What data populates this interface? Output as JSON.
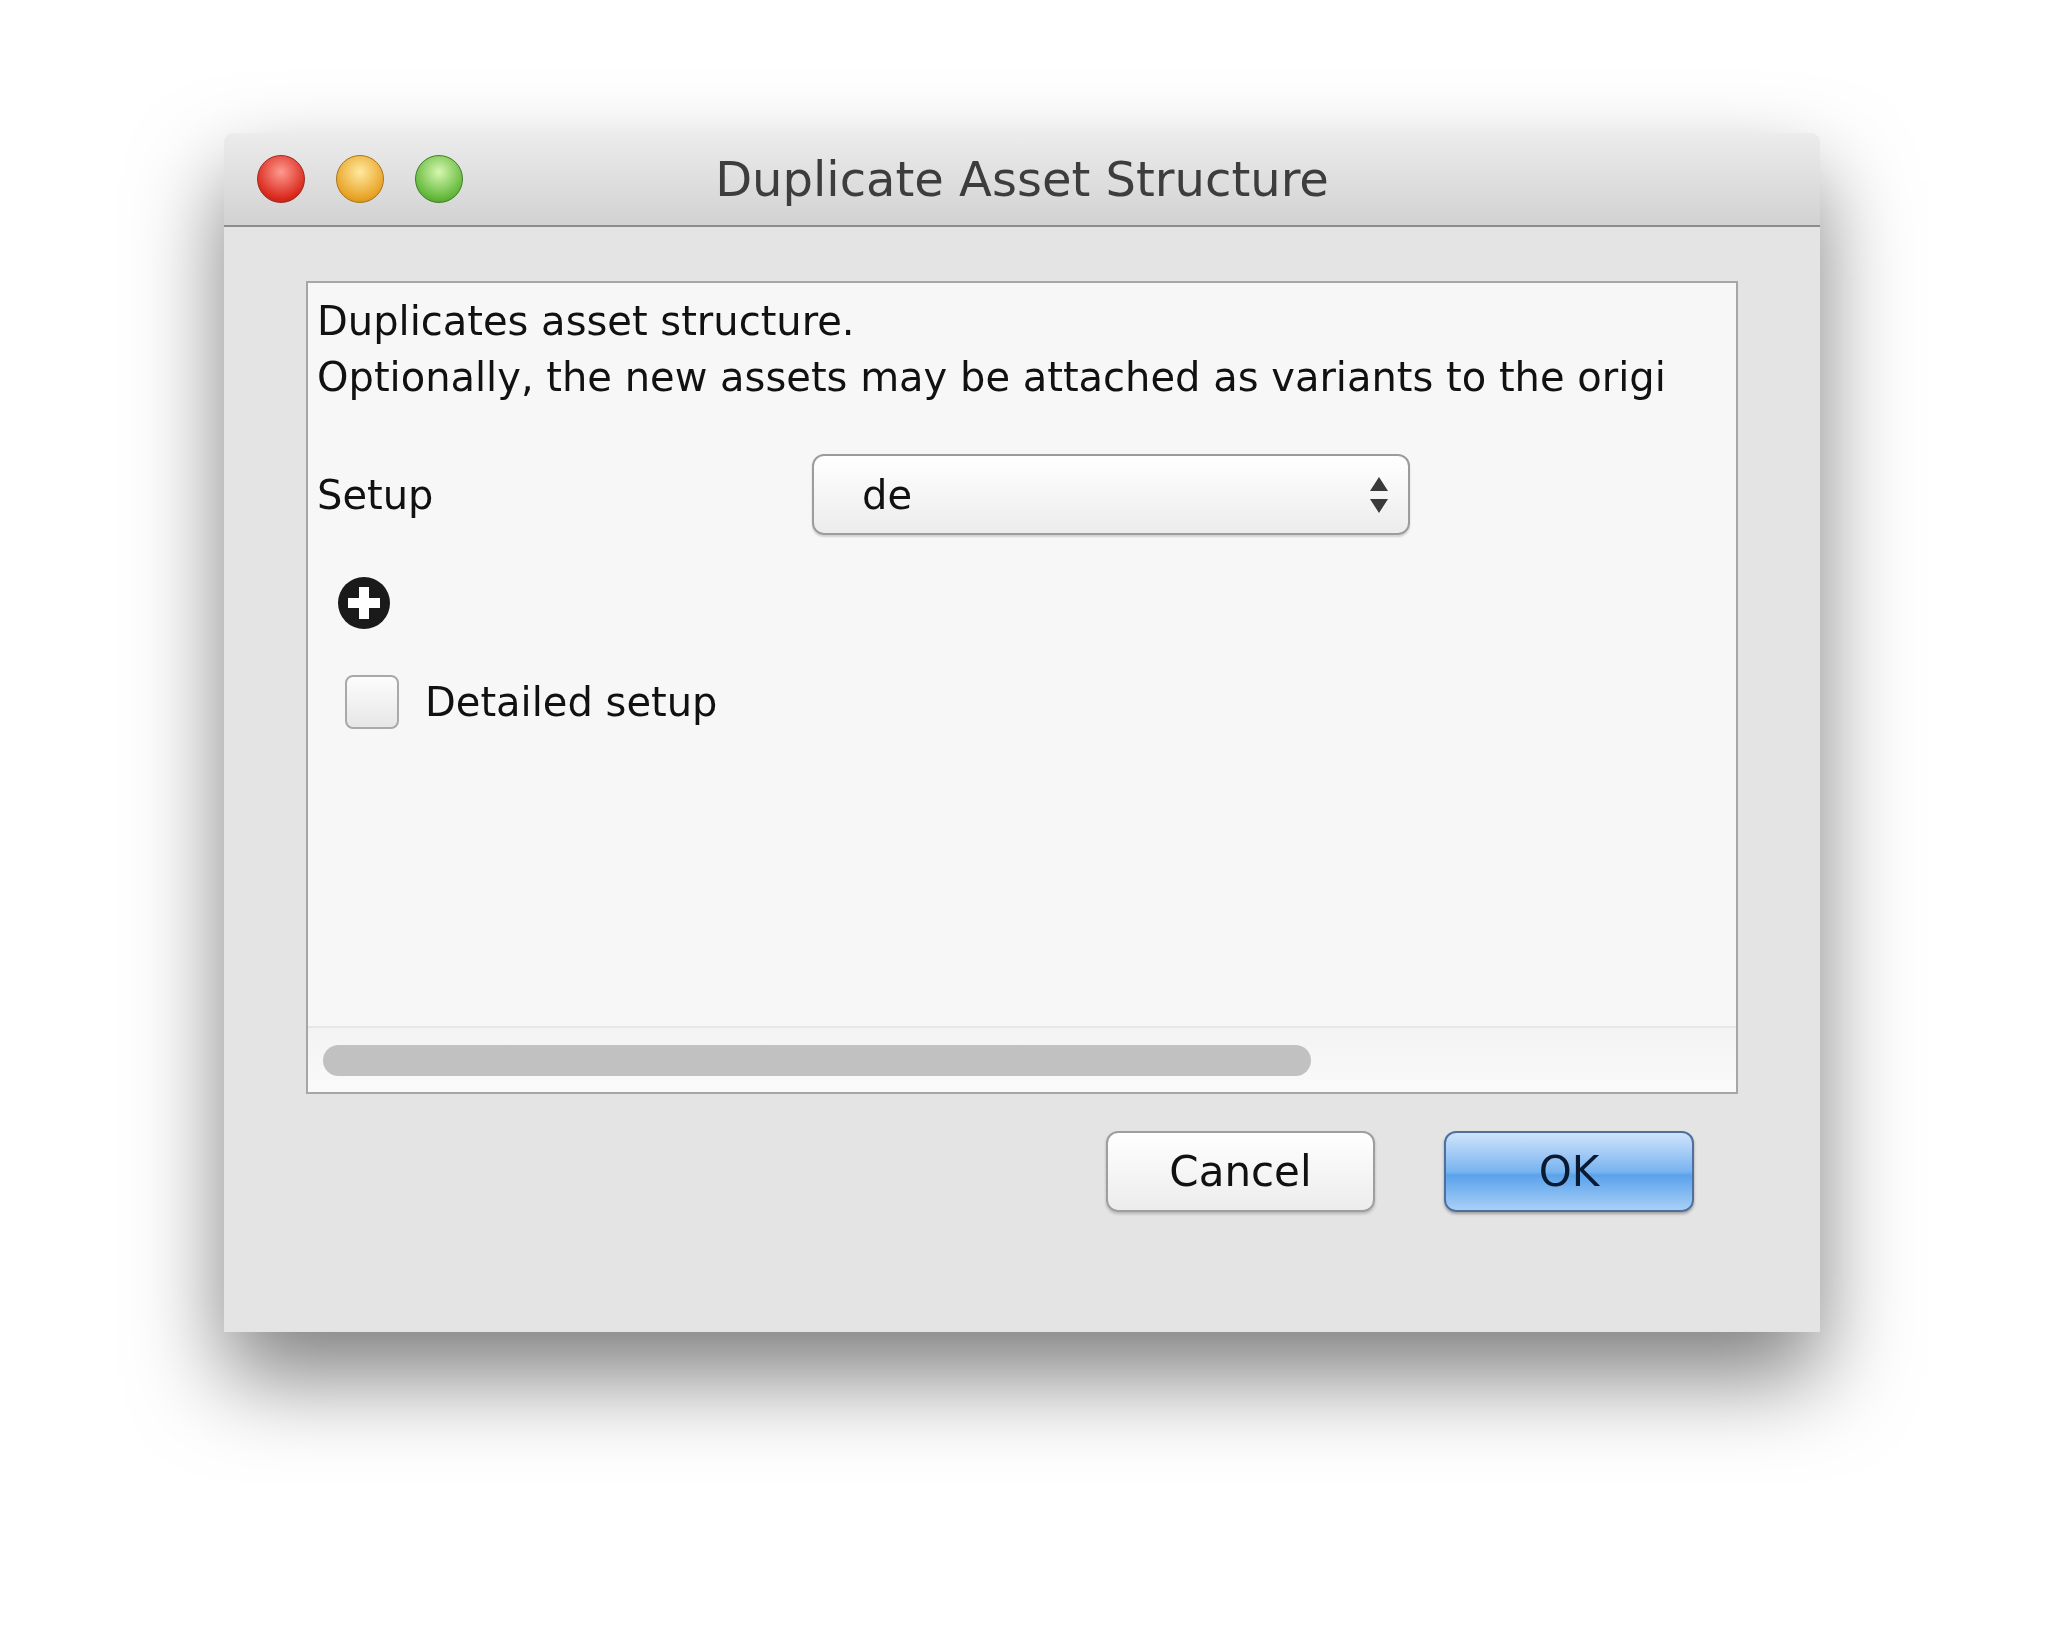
{
  "window": {
    "title": "Duplicate Asset Structure"
  },
  "description": [
    "Duplicates asset structure.",
    "Optionally, the new assets may be attached as variants to the origi"
  ],
  "setup": {
    "label": "Setup",
    "value": "de"
  },
  "detailed_setup": {
    "label": "Detailed setup",
    "checked": false
  },
  "buttons": [
    {
      "label": "Cancel",
      "default": false
    },
    {
      "label": "OK",
      "default": true
    }
  ]
}
